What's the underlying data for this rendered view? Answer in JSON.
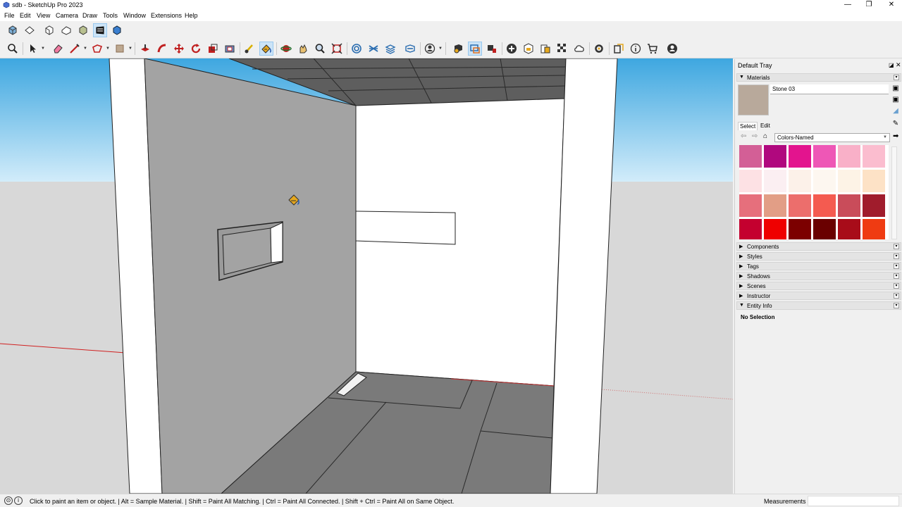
{
  "window": {
    "title": "sdb - SketchUp Pro 2023",
    "minimize": "—",
    "maximize": "❐",
    "close": "✕"
  },
  "menu": [
    "File",
    "Edit",
    "View",
    "Camera",
    "Draw",
    "Tools",
    "Window",
    "Extensions",
    "Help"
  ],
  "tray": {
    "title": "Default Tray",
    "materials_panel": "Materials",
    "current_material": "Stone 03",
    "current_material_color": "#b8a99b",
    "tab_select": "Select",
    "tab_edit": "Edit",
    "library": "Colors-Named",
    "swatches": [
      "#d35f96",
      "#b0087e",
      "#e3148e",
      "#ee57b6",
      "#f9b0c8",
      "#fbbdcf",
      "#fde1e4",
      "#fbeff2",
      "#fcf1e9",
      "#fdf7f0",
      "#fdf3e6",
      "#fde2c6",
      "#e66f7c",
      "#e29e86",
      "#ec6e6c",
      "#f45b50",
      "#c94c5a",
      "#a01c2c",
      "#c4002f",
      "#ef0000",
      "#7c0000",
      "#6a0000",
      "#a80c19",
      "#ef3b12"
    ],
    "panels": [
      "Components",
      "Styles",
      "Tags",
      "Shadows",
      "Scenes",
      "Instructor",
      "Entity Info"
    ],
    "entity_info": "No Selection"
  },
  "status": {
    "hint": "Click to paint an item or object. | Alt = Sample Material. | Shift = Paint All Matching. | Ctrl = Paint All Connected. | Shift + Ctrl = Paint All on Same Object.",
    "measurements_label": "Measurements",
    "measurements_value": ""
  },
  "toolbar": {
    "views": [
      "iso-view-icon",
      "top-view-icon",
      "front-view-icon",
      "right-view-icon",
      "back-view-icon",
      "left-view-icon",
      "bottom-view-icon"
    ],
    "active_view": "left-view-icon",
    "tools": [
      "zoom-window-icon",
      "select-icon",
      "eraser-icon",
      "line-icon",
      "shapes-icon",
      "paint-bucket-icon",
      "push-pull-icon",
      "follow-me-icon",
      "move-icon",
      "rotate-icon",
      "scale-icon",
      "offset-icon",
      "tape-measure-icon",
      "paint-icon",
      "orbit-icon",
      "pan-icon",
      "zoom-icon",
      "zoom-extents-icon",
      "sandbox-icon",
      "contour-icon",
      "stamp-icon",
      "drape-icon",
      "profile-icon",
      "warehouse-icon",
      "section-plane-icon",
      "components-icon",
      "model-info-icon",
      "add-location-icon",
      "shield-icon",
      "layout-icon",
      "match-photo-icon",
      "cloud-icon",
      "extensions-icon",
      "style-builder-icon",
      "info-icon",
      "store-icon",
      "account-icon"
    ],
    "active_tool": "paint-icon"
  },
  "colors": {
    "accent": "#0078d7",
    "sky_top": "#3ea7e0",
    "sky_bottom": "#d2ecfa",
    "ground": "#d8d8d8"
  }
}
